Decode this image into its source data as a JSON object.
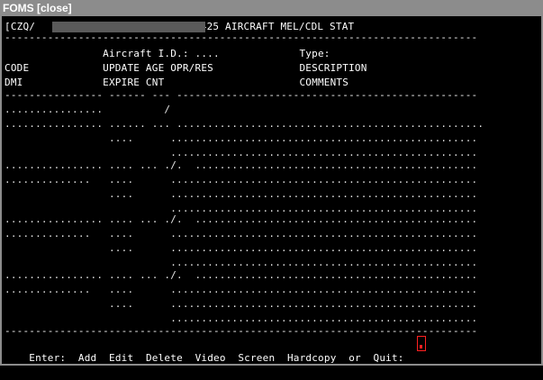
{
  "window": {
    "title": "FOMS [close]"
  },
  "header": {
    "id_prefix": "[CZQ/",
    "id_suffix": "] 425 AIRCRAFT MEL/CDL STAT",
    "sep": "-----------------------------------------------------------------------------",
    "aircraft_row": "                Aircraft I.D.: ....             Type:",
    "col_row1": "CODE            UPDATE AGE OPR/RES              DESCRIPTION",
    "col_row2": "DMI             EXPIRE CNT                      COMMENTS",
    "rule": "---------------- ------ --- -------------------------------------------------"
  },
  "records": [
    {
      "r1": "................          /",
      "r2": "................ ...... ... ..................................................",
      "r3": "                 ....      ..................................................",
      "r4": "                           .................................................."
    },
    {
      "r1": "................ .... ... ./.  ..............................................",
      "r2": "..............   ....      ..................................................",
      "r3": "                 ....      ..................................................",
      "r4": "                           .................................................."
    },
    {
      "r1": "................ .... ... ./.  ..............................................",
      "r2": "..............   ....      ..................................................",
      "r3": "                 ....      ..................................................",
      "r4": "                           .................................................."
    },
    {
      "r1": "................ .... ... ./.  ..............................................",
      "r2": "..............   ....      ..................................................",
      "r3": "                 ....      ..................................................",
      "r4": "                           .................................................."
    }
  ],
  "footer_rule": "-----------------------------------------------------------------------------",
  "footer": {
    "prompt": "Enter:",
    "options": [
      "Add",
      "Edit",
      "Delete",
      "Video",
      "Screen",
      "Hardcopy"
    ],
    "or_text": "or",
    "quit": "Quit:",
    "input_value": "."
  },
  "colors": {
    "background": "#000000",
    "text": "#ffffff",
    "titlebar": "#8c8c8c",
    "cursor": "#ff2020"
  }
}
